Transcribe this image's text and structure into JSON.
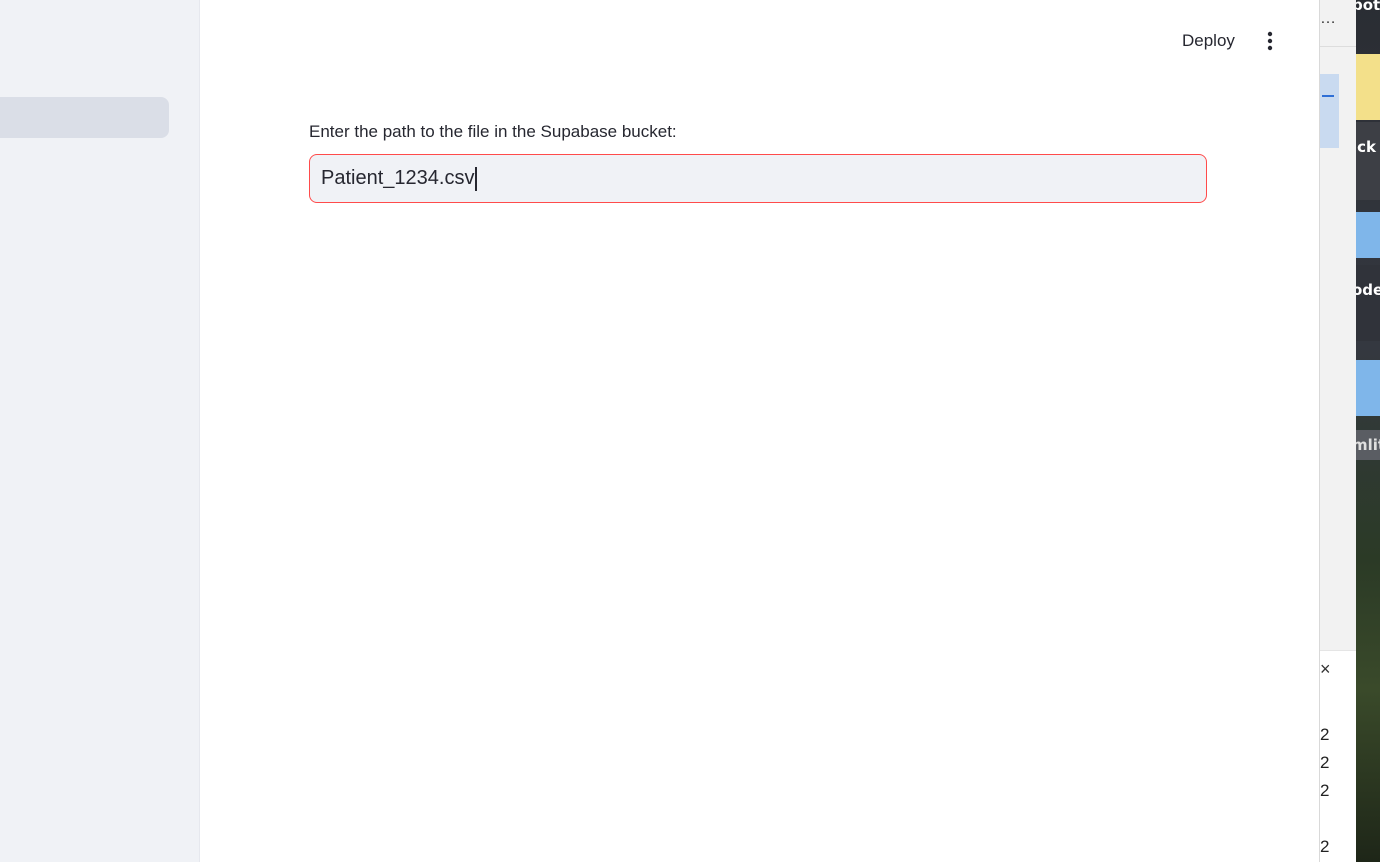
{
  "app": {
    "toolbar": {
      "deploy_label": "Deploy",
      "menu_icon": "vertical-ellipsis-icon"
    },
    "form": {
      "path_input": {
        "label": "Enter the path to the file in the Supabase bucket:",
        "value": "Patient_1234.csv"
      }
    },
    "colors": {
      "accent": "#ff4b4b",
      "sidebar_bg": "#f0f2f6",
      "input_bg": "#f0f2f6",
      "text": "#262730"
    }
  },
  "background_window": {
    "overflow_icon": "…",
    "close_icon": "×",
    "visible_digits": [
      "2",
      "2",
      "2",
      "2"
    ]
  },
  "desktop": {
    "partial_labels": [
      "pot",
      "ick",
      "ode",
      "mlit"
    ]
  }
}
